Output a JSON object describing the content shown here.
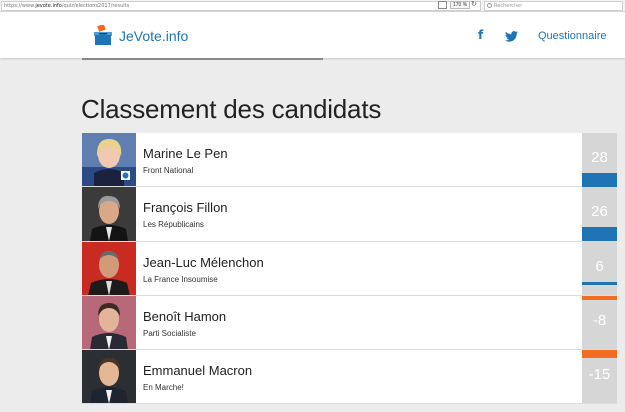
{
  "browser": {
    "url_prefix": "https://www.",
    "url_domain": "jevote.info",
    "url_path": "/quiz/elections2017/results",
    "zoom": "170 %",
    "search_placeholder": "Rechercher"
  },
  "header": {
    "brand": "JeVote.info",
    "nav": {
      "facebook": "f",
      "questionnaire": "Questionnaire"
    }
  },
  "main": {
    "title": "Classement des candidats",
    "candidates": [
      {
        "name": "Marine Le Pen",
        "party": "Front National",
        "score": "28",
        "score_value": 28,
        "photo": "portrait-blonde-woman",
        "accent": "#1f74b6"
      },
      {
        "name": "François Fillon",
        "party": "Les Républicains",
        "score": "26",
        "score_value": 26,
        "photo": "portrait-grey-haired-man",
        "accent": "#1f74b6"
      },
      {
        "name": "Jean-Luc Mélenchon",
        "party": "La France Insoumise",
        "score": "6",
        "score_value": 6,
        "photo": "portrait-man-red-background",
        "accent": "#1f74b6"
      },
      {
        "name": "Benoît Hamon",
        "party": "Parti Socialiste",
        "score": "-8",
        "score_value": -8,
        "photo": "portrait-man-pink-background",
        "accent": "#f26d21"
      },
      {
        "name": "Emmanuel Macron",
        "party": "En Marche!",
        "score": "-15",
        "score_value": -15,
        "photo": "portrait-man-dark-background",
        "accent": "#f26d21"
      }
    ]
  },
  "colors": {
    "positive": "#1f74b6",
    "negative": "#f26d21",
    "brand": "#1f74b6"
  }
}
